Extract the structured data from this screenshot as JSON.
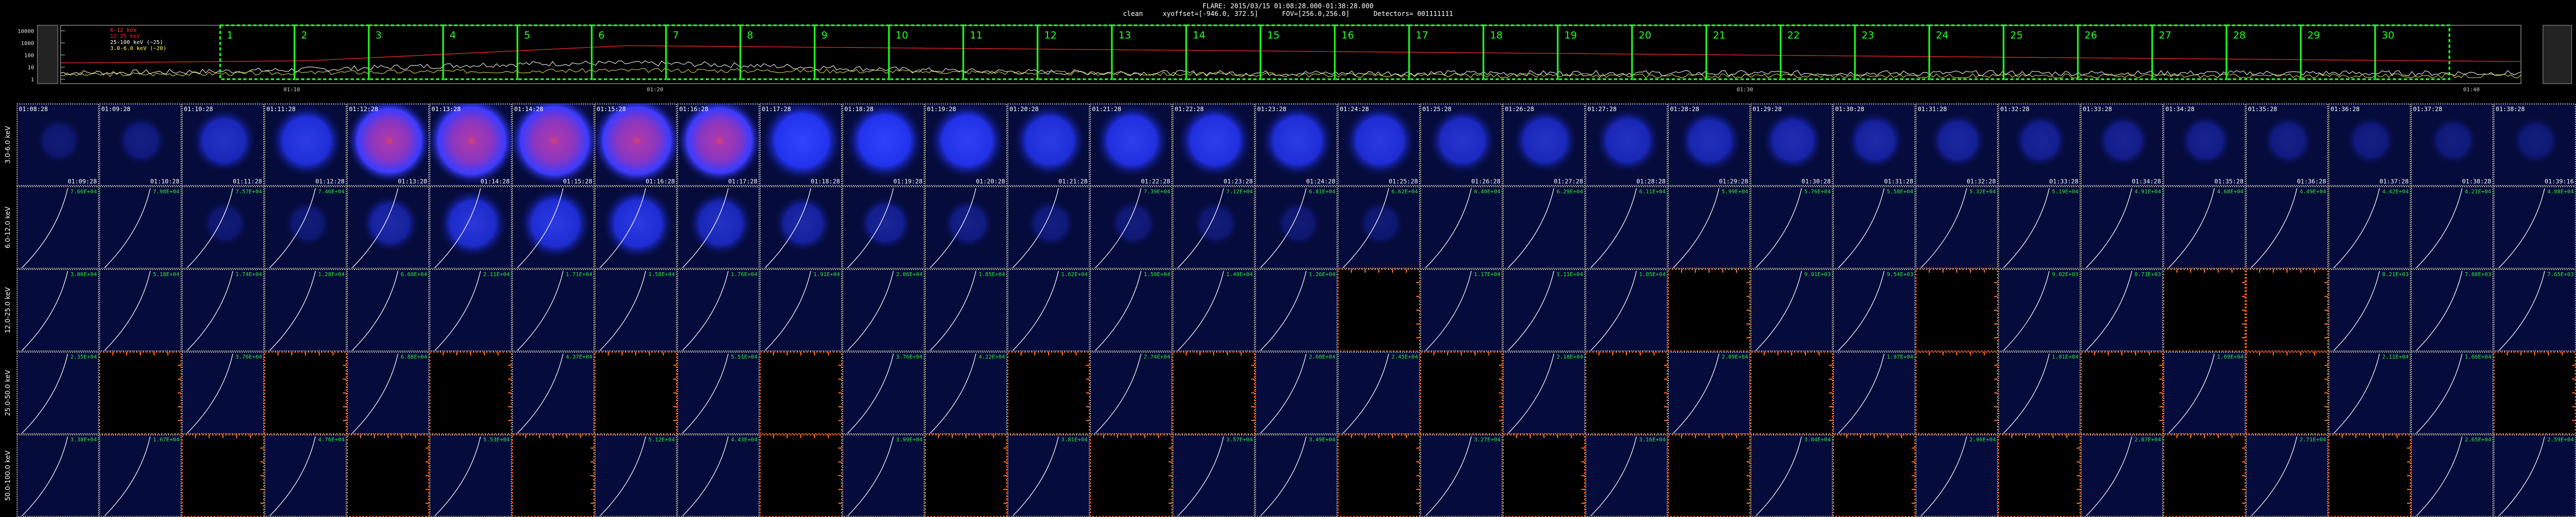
{
  "header": {
    "title": "FLARE: 2015/03/15 01:08:28.000-01:38:28.000",
    "subtitle": "clean     xyoffset=[-946.0, 372.5]      FOV=[256.0,256.0]      Detectors= 001111111"
  },
  "timeline": {
    "y_ticks": [
      "10000",
      "1000",
      "100",
      "10",
      "1"
    ],
    "legend": [
      {
        "label": "6-12 keV",
        "color": "#ff3b3b"
      },
      {
        "label": "12-25 keV",
        "color": "#ff2222"
      },
      {
        "label": "25-100 keV (~25)",
        "color": "#ffffff"
      },
      {
        "label": "3.0-6.0 keV (~20)",
        "color": "#ffff66"
      }
    ],
    "interval_numbers": [
      "1",
      "2",
      "3",
      "4",
      "5",
      "6",
      "7",
      "8",
      "9",
      "10",
      "11",
      "12",
      "13",
      "14",
      "15",
      "16",
      "17",
      "18",
      "19",
      "20",
      "21",
      "22",
      "23",
      "24",
      "25",
      "26",
      "27",
      "28",
      "29",
      "30"
    ],
    "axis_labels": [
      "01:10",
      "01:20",
      "01:30",
      "01:40"
    ],
    "colors": {
      "interval_box": "#22ff22",
      "curve_red": "#ff2b2b",
      "curve_white": "#ffffff",
      "curve_yellow": "#dede55"
    }
  },
  "row_labels": [
    "3.0-6.0 keV",
    "6.0-12.0 keV",
    "12.0-25.0 keV",
    "25.0-50.0 keV",
    "50.0-100.0 keV"
  ],
  "start_times": [
    "01:08:28",
    "01:09:28",
    "01:10:28",
    "01:11:28",
    "01:12:28",
    "01:13:28",
    "01:14:28",
    "01:15:28",
    "01:16:28",
    "01:17:28",
    "01:18:28",
    "01:19:28",
    "01:20:28",
    "01:21:28",
    "01:22:28",
    "01:23:28",
    "01:24:28",
    "01:25:28",
    "01:26:28",
    "01:27:28",
    "01:28:28",
    "01:29:28",
    "01:30:28",
    "01:31:28",
    "01:32:28",
    "01:33:28",
    "01:34:28",
    "01:35:28",
    "01:36:28",
    "01:37:28",
    "01:38:28"
  ],
  "end_times": [
    "01:09:28",
    "01:10:28",
    "01:11:28",
    "01:12:28",
    "01:13:28",
    "01:14:28",
    "01:15:28",
    "01:16:28",
    "01:17:28",
    "01:18:28",
    "01:19:28",
    "01:20:28",
    "01:21:28",
    "01:22:28",
    "01:23:28",
    "01:24:28",
    "01:25:28",
    "01:26:28",
    "01:27:28",
    "01:28:28",
    "01:29:28",
    "01:30:28",
    "01:31:28",
    "01:32:28",
    "01:33:28",
    "01:34:28",
    "01:35:28",
    "01:36:28",
    "01:37:28",
    "01:38:28",
    "01:39:16"
  ],
  "intensity": [
    [
      0.05,
      0.12,
      0.45,
      0.62,
      0.88,
      0.98,
      1.0,
      0.98,
      0.9,
      0.82,
      0.74,
      0.7,
      0.62,
      0.66,
      0.66,
      0.62,
      0.6,
      0.5,
      0.46,
      0.44,
      0.4,
      0.36,
      0.3,
      0.26,
      0.22,
      0.2,
      0.18,
      0.14,
      0.12,
      0.1,
      0.08
    ],
    [
      0.03,
      0.04,
      0.05,
      0.06,
      0.3,
      0.55,
      0.6,
      0.6,
      0.45,
      0.3,
      0.22,
      0.14,
      0.1,
      0.08,
      0.06,
      0.05,
      0.05,
      0.04,
      0.04,
      0.04,
      0.03,
      0.03,
      0.03,
      0.03,
      0.03,
      0.03,
      0.03,
      0.03,
      0.03,
      0.03,
      0.03
    ],
    [
      0.02,
      0.02,
      0.02,
      0.02,
      0.04,
      0.04,
      0.03,
      0.03,
      0.02,
      0.02,
      0.02,
      0.02,
      0.02,
      0.02,
      0.02,
      0.02,
      0.02,
      0.02,
      0.02,
      0.02,
      0.02,
      0.02,
      0.02,
      0.02,
      0.02,
      0.02,
      0.02,
      0.02,
      0.02,
      0.02,
      0.02
    ],
    [
      0.02,
      0.02,
      0.02,
      0.02,
      0.02,
      0.02,
      0.02,
      0.02,
      0.02,
      0.02,
      0.02,
      0.02,
      0.02,
      0.02,
      0.02,
      0.02,
      0.02,
      0.02,
      0.02,
      0.02,
      0.02,
      0.02,
      0.02,
      0.02,
      0.02,
      0.02,
      0.02,
      0.02,
      0.02,
      0.02,
      0.02
    ],
    [
      0.02,
      0.02,
      0.02,
      0.02,
      0.02,
      0.02,
      0.02,
      0.02,
      0.02,
      0.02,
      0.02,
      0.02,
      0.02,
      0.02,
      0.02,
      0.02,
      0.02,
      0.02,
      0.02,
      0.02,
      0.02,
      0.02,
      0.02,
      0.02,
      0.02,
      0.02,
      0.02,
      0.02,
      0.02,
      0.02,
      0.02
    ]
  ],
  "missing": [
    [],
    [],
    [
      16,
      20,
      23,
      26,
      27
    ],
    [
      1,
      3,
      5,
      7,
      9,
      12,
      14,
      17,
      19,
      21,
      23,
      25,
      27,
      30
    ],
    [
      2,
      4,
      6,
      9,
      11,
      13,
      16,
      18,
      20,
      22,
      24,
      26,
      28
    ]
  ],
  "values": [
    [
      "",
      "",
      "",
      "",
      "",
      "",
      "",
      "",
      "",
      "",
      "",
      "",
      "",
      "",
      "",
      "",
      "",
      "",
      "",
      "",
      "",
      "",
      "",
      "",
      "",
      "",
      "",
      "",
      "",
      "",
      ""
    ],
    [
      "7.66E+04",
      "7.98E+04",
      "7.57E+04",
      "7.46E+04",
      "",
      "",
      "",
      "",
      "",
      "",
      "",
      "",
      "",
      "7.39E+04",
      "7.12E+04",
      "6.81E+04",
      "6.62E+04",
      "6.40E+04",
      "6.29E+04",
      "6.11E+04",
      "5.99E+04",
      "5.76E+04",
      "5.58E+04",
      "5.32E+04",
      "5.19E+04",
      "4.91E+04",
      "4.68E+04",
      "4.49E+04",
      "4.42E+04",
      "4.21E+04",
      "4.08E+04"
    ],
    [
      "3.06E+04",
      "5.18E+04",
      "1.74E+04",
      "1.28E+04",
      "6.60E+04",
      "2.11E+04",
      "1.71E+04",
      "1.58E+04",
      "1.76E+04",
      "1.91E+04",
      "2.06E+04",
      "1.85E+04",
      "1.62E+04",
      "1.50E+04",
      "1.40E+04",
      "1.26E+04",
      "",
      "1.17E+04",
      "1.11E+04",
      "1.05E+04",
      "",
      "9.91E+03",
      "9.54E+03",
      "",
      "9.02E+03",
      "8.73E+03",
      "",
      "",
      "8.21E+03",
      "7.88E+03",
      "7.65E+03"
    ],
    [
      "2.35E+04",
      "",
      "3.76E+04",
      "",
      "6.88E+04",
      "",
      "4.37E+04",
      "",
      "5.51E+04",
      "",
      "3.76E+04",
      "4.22E+04",
      "",
      "2.74E+04",
      "",
      "2.60E+04",
      "2.45E+04",
      "",
      "2.18E+04",
      "",
      "2.09E+04",
      "",
      "1.97E+04",
      "",
      "1.81E+04",
      "",
      "1.69E+04",
      "",
      "2.11E+04",
      "1.66E+04",
      ""
    ],
    [
      "3.38E+04",
      "1.67E+04",
      "",
      "4.76E+04",
      "",
      "5.53E+04",
      "",
      "5.12E+04",
      "4.43E+04",
      "",
      "3.99E+04",
      "",
      "3.81E+04",
      "",
      "3.57E+04",
      "3.49E+04",
      "",
      "3.27E+04",
      "",
      "3.16E+04",
      "",
      "3.04E+04",
      "",
      "2.96E+04",
      "",
      "2.87E+04",
      "",
      "2.71E+04",
      "2.80E+04",
      "2.65E+04",
      "2.59E+04"
    ]
  ],
  "colors": {
    "panel_bg": "#050b3a",
    "cell_border": "#dddddd",
    "missing_border": "#ff6a1a",
    "value_text": "#31e631",
    "time_text": "#ffffff",
    "curve": "#ffffff"
  }
}
